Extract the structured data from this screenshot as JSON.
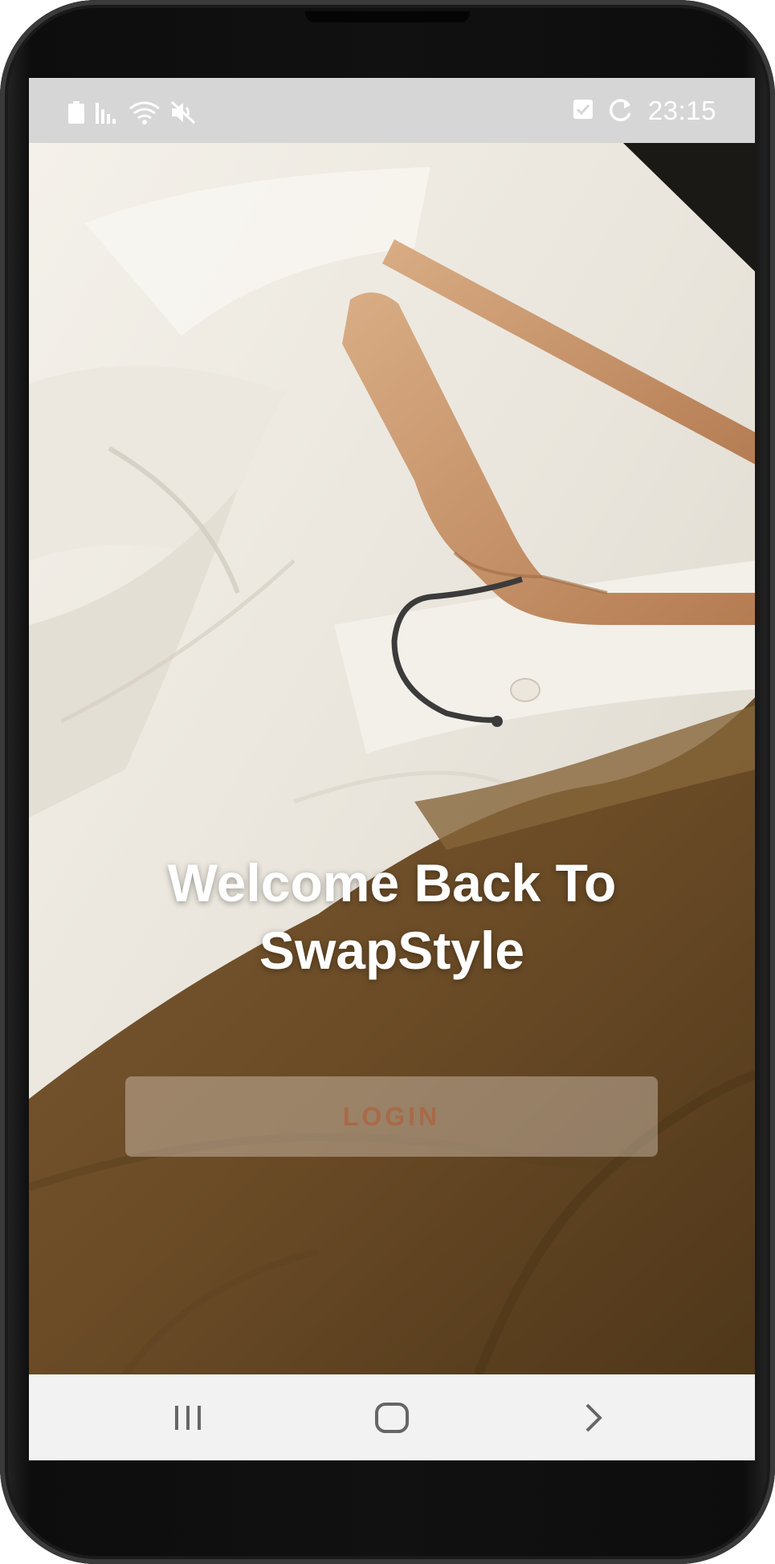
{
  "status_bar": {
    "time": "23:15",
    "left_icons": [
      "battery-icon",
      "signal-icon",
      "wifi-icon",
      "mute-icon"
    ],
    "right_icons": [
      "checkbox-notification-icon",
      "sync-icon"
    ]
  },
  "main": {
    "welcome_title": "Welcome Back To SwapStyle",
    "login_label": "LOGIN"
  },
  "nav_bar": {
    "buttons": [
      "recents-icon",
      "home-icon",
      "back-icon"
    ]
  },
  "colors": {
    "status_bar_bg": "#d6d6d6",
    "nav_bar_bg": "#f2f2f2",
    "login_text": "#a86a48",
    "welcome_text": "#ffffff"
  }
}
